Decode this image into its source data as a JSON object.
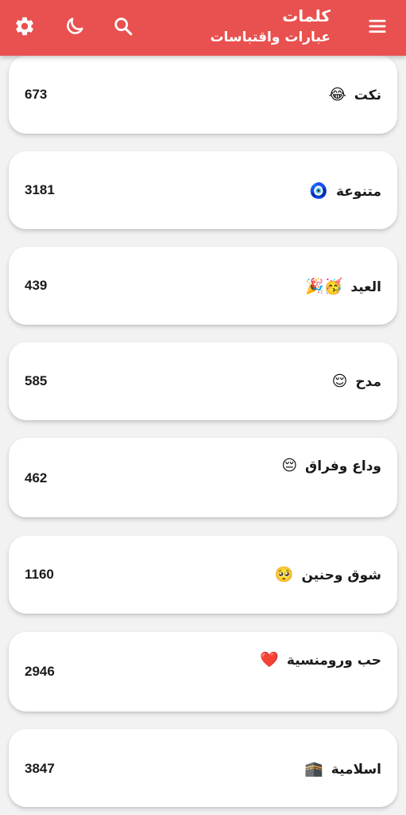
{
  "header": {
    "title": "كلمات",
    "subtitle": "عبارات واقتباسات",
    "icons": [
      "gear-icon",
      "moon-icon",
      "search-icon",
      "menu-icon"
    ],
    "background_color": "#e8514f"
  },
  "categories": [
    {
      "name": "نكت",
      "emoji": "😂",
      "count": "673"
    },
    {
      "name": "متنوعة",
      "emoji": "🧿",
      "count": "3181"
    },
    {
      "name": "العيد",
      "emoji": "🥳🎉",
      "count": "439"
    },
    {
      "name": "مدح",
      "emoji": "😌",
      "count": "585"
    },
    {
      "name": "وداع وفراق",
      "emoji": "😔",
      "count": "462"
    },
    {
      "name": "شوق وحنين",
      "emoji": "🥺",
      "count": "1160"
    },
    {
      "name": "حب ورومنسية",
      "emoji": "❤️",
      "count": "2946"
    },
    {
      "name": "اسلامية",
      "emoji": "🕋",
      "count": "3847"
    }
  ]
}
